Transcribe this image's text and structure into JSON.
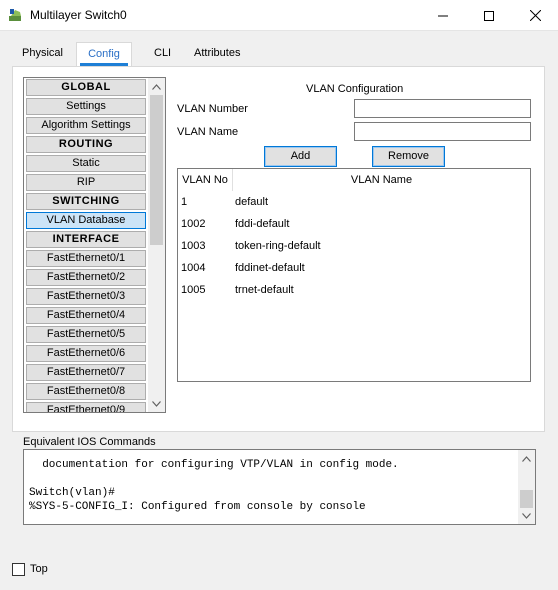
{
  "window": {
    "title": "Multilayer Switch0",
    "icon": "switch-app-icon",
    "controls": [
      "minimize-icon",
      "maximize-icon",
      "close-icon"
    ]
  },
  "tabs": [
    {
      "label": "Physical",
      "active": false
    },
    {
      "label": "Config",
      "active": true
    },
    {
      "label": "CLI",
      "active": false
    },
    {
      "label": "Attributes",
      "active": false
    }
  ],
  "nav": {
    "items": [
      {
        "label": "GLOBAL",
        "section": true
      },
      {
        "label": "Settings"
      },
      {
        "label": "Algorithm Settings"
      },
      {
        "label": "ROUTING",
        "section": true
      },
      {
        "label": "Static"
      },
      {
        "label": "RIP"
      },
      {
        "label": "SWITCHING",
        "section": true
      },
      {
        "label": "VLAN Database",
        "selected": true
      },
      {
        "label": "INTERFACE",
        "section": true
      },
      {
        "label": "FastEthernet0/1"
      },
      {
        "label": "FastEthernet0/2"
      },
      {
        "label": "FastEthernet0/3"
      },
      {
        "label": "FastEthernet0/4"
      },
      {
        "label": "FastEthernet0/5"
      },
      {
        "label": "FastEthernet0/6"
      },
      {
        "label": "FastEthernet0/7"
      },
      {
        "label": "FastEthernet0/8"
      },
      {
        "label": "FastEthernet0/9"
      }
    ]
  },
  "vlan_config": {
    "title": "VLAN Configuration",
    "number_label": "VLAN Number",
    "number_value": "",
    "name_label": "VLAN Name",
    "name_value": "",
    "add_label": "Add",
    "remove_label": "Remove",
    "columns": [
      "VLAN No",
      "VLAN Name"
    ],
    "rows": [
      {
        "no": "1",
        "name": "default"
      },
      {
        "no": "1002",
        "name": "fddi-default"
      },
      {
        "no": "1003",
        "name": "token-ring-default"
      },
      {
        "no": "1004",
        "name": "fddinet-default"
      },
      {
        "no": "1005",
        "name": "trnet-default"
      }
    ]
  },
  "ios": {
    "label": "Equivalent IOS Commands",
    "lines": [
      "  documentation for configuring VTP/VLAN in config mode.",
      "",
      "Switch(vlan)#",
      "%SYS-5-CONFIG_I: Configured from console by console"
    ]
  },
  "footer": {
    "top_label": "Top",
    "top_checked": false
  },
  "colors": {
    "accent": "#1e7fd6",
    "selected_bg": "#cce4f7",
    "button_border": "#0078d7"
  }
}
